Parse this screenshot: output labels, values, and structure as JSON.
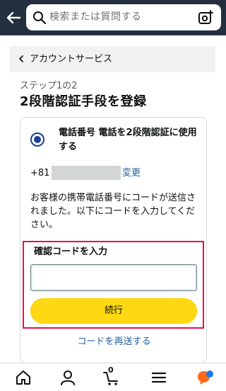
{
  "header": {
    "search_placeholder": "検索または質問する",
    "back_icon": "back-arrow-icon",
    "search_icon": "search-icon",
    "camera_icon": "camera-scan-icon"
  },
  "breadcrumb": {
    "label": "アカウントサービス"
  },
  "page": {
    "step_label": "ステップ1の2",
    "title": "2段階認証手段を登録"
  },
  "option": {
    "selected": true,
    "text": "電話番号 電話を2段階認証に使用する"
  },
  "phone": {
    "prefix": "+81",
    "change_label": "変更"
  },
  "notice": "お客様の携帯電話番号にコードが送信されました。以下にコードを入力してください。",
  "code_entry": {
    "label": "確認コードを入力",
    "value": "",
    "continue_label": "続行"
  },
  "resend_label": "コードを再送する",
  "bottom_nav": {
    "items": [
      "home-icon",
      "account-icon",
      "cart-icon",
      "menu-icon",
      "assistant-icon"
    ],
    "cart_count": "0"
  },
  "colors": {
    "header_bg": "#232f3e",
    "link": "#2162a1",
    "button_yellow": "#ffd814",
    "highlight_red": "#e8104a",
    "radio_blue": "#1a3f9c"
  }
}
